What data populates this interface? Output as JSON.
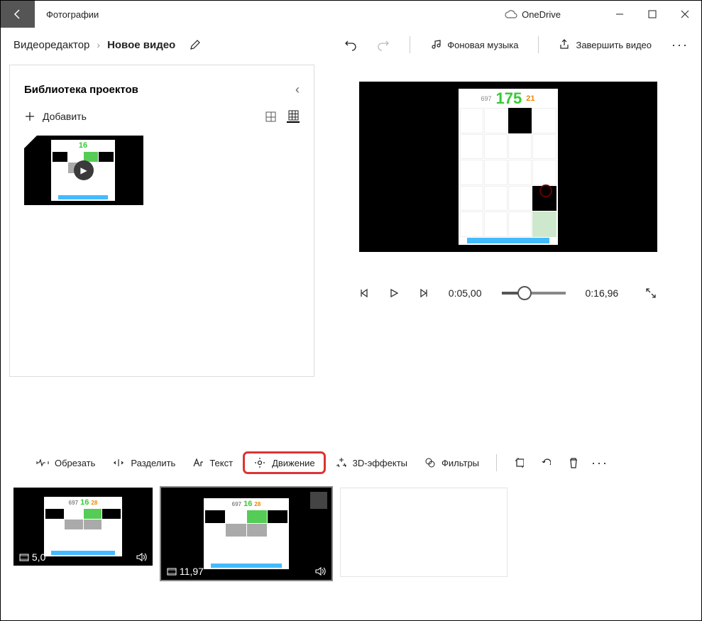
{
  "titlebar": {
    "app": "Фотографии",
    "onedrive": "OneDrive"
  },
  "breadcrumb": {
    "root": "Видеоредактор",
    "current": "Новое видео"
  },
  "toolbar": {
    "music": "Фоновая музыка",
    "finish": "Завершить видео"
  },
  "panel": {
    "title": "Библиотека проектов",
    "add": "Добавить",
    "thumb_score": "16"
  },
  "preview": {
    "score_left": "697",
    "score_main": "175",
    "score_right": "21"
  },
  "player": {
    "current": "0:05,00",
    "total": "0:16,96"
  },
  "clipbar": {
    "trim": "Обрезать",
    "split": "Разделить",
    "text": "Текст",
    "motion": "Движение",
    "fx": "3D-эффекты",
    "filters": "Фильтры"
  },
  "clips": [
    {
      "dur": "5,0",
      "score": "16",
      "left": "697",
      "right": "28"
    },
    {
      "dur": "11,97",
      "score": "16",
      "left": "697",
      "right": "28"
    }
  ]
}
